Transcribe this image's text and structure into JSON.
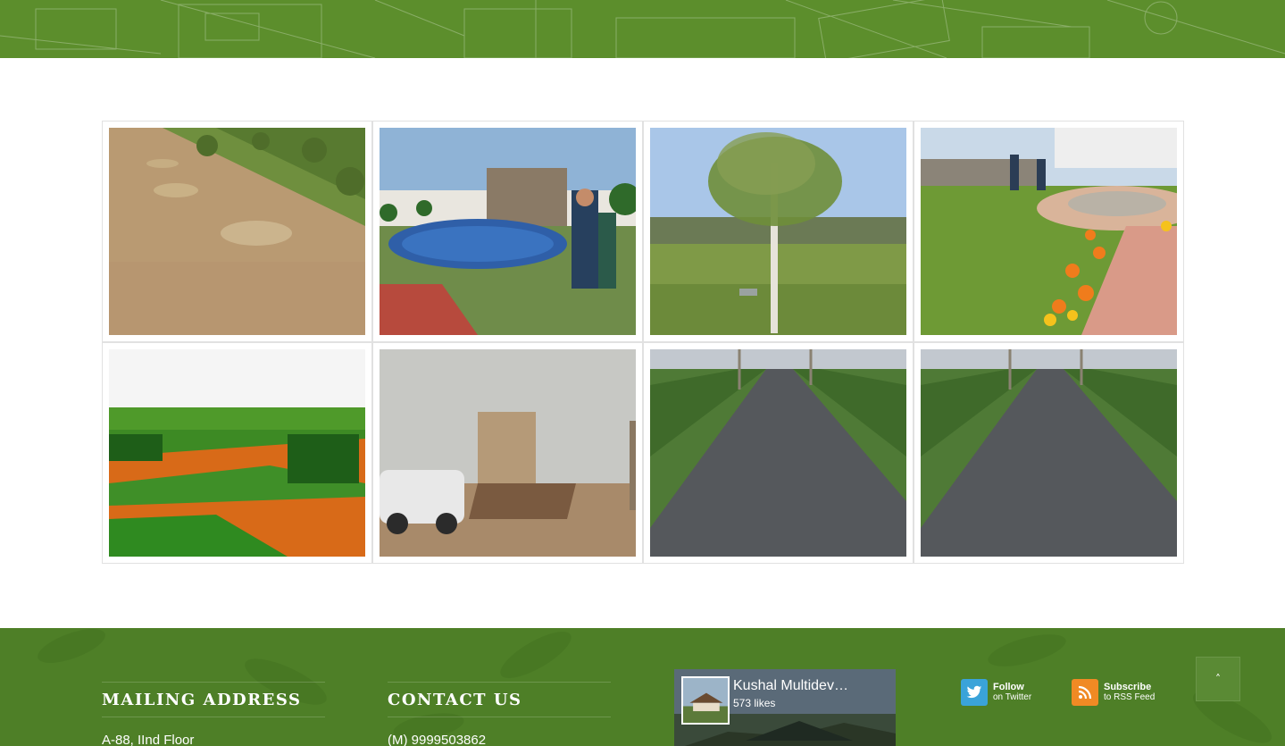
{
  "header": {
    "band_color": "#5c8e2c"
  },
  "gallery": {
    "items": [
      {
        "name": "gallery-image-dry-slope"
      },
      {
        "name": "gallery-image-pool"
      },
      {
        "name": "gallery-image-tree-lawn"
      },
      {
        "name": "gallery-image-garden-fountain"
      },
      {
        "name": "gallery-image-nursery-field"
      },
      {
        "name": "gallery-image-car-wall"
      },
      {
        "name": "gallery-image-road-1"
      },
      {
        "name": "gallery-image-road-2"
      }
    ]
  },
  "footer": {
    "background": "#4e7f27",
    "mailing": {
      "title": "MAILING ADDRESS",
      "line1": "A-88, IInd Floor"
    },
    "contact": {
      "title": "CONTACT US",
      "line1": "(M) 9999503862"
    },
    "facebook": {
      "page_name": "Kushal Multidev…",
      "likes": "573 likes"
    },
    "twitter": {
      "line1": "Follow",
      "line2": "on Twitter",
      "icon": "twitter-icon",
      "color": "#3aa3d9"
    },
    "rss": {
      "line1": "Subscribe",
      "line2": "to RSS Feed",
      "icon": "rss-icon",
      "color": "#f08a24"
    }
  },
  "scroll_top": {
    "icon": "chevron-up-icon",
    "glyph": "˄"
  }
}
